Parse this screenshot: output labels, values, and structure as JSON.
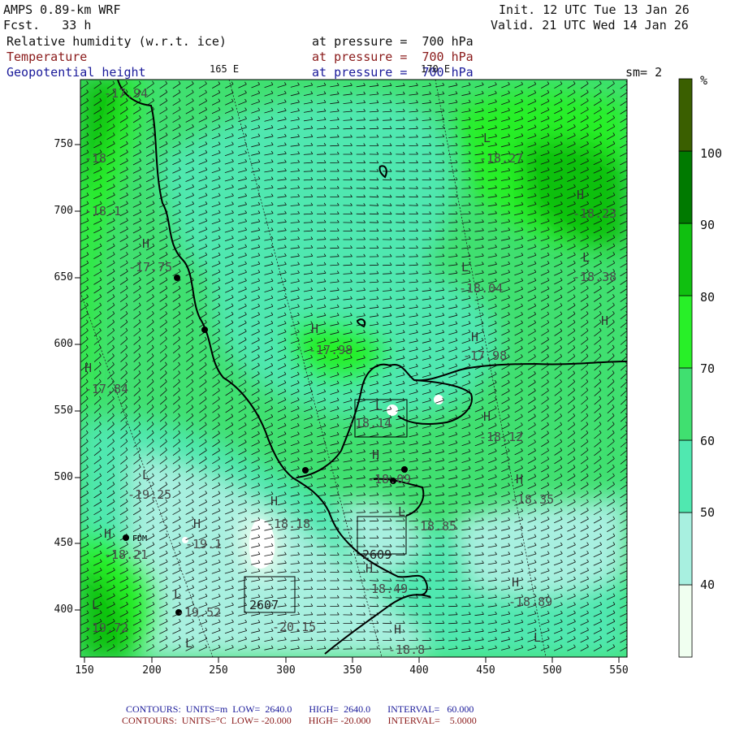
{
  "header": {
    "model": "AMPS 0.89-km WRF",
    "forecast": "Fcst.   33 h",
    "init": "Init. 12 UTC Tue 13 Jan 26",
    "valid": "Valid. 21 UTC Wed 14 Jan 26",
    "field1_name": "Relative humidity (w.r.t. ice)",
    "field1_level": "at pressure =  700 hPa",
    "field2_name": "Temperature",
    "field2_level": "at pressure =  700 hPa",
    "field3_name": "Geopotential height",
    "field3_level": "at pressure =  700 hPa",
    "smoothing": "sm= 2",
    "lon_label_1": "165 E",
    "lon_label_2": "170 E"
  },
  "axes": {
    "y_ticks": [
      "750",
      "700",
      "650",
      "600",
      "550",
      "500",
      "450",
      "400"
    ],
    "x_ticks": [
      "150",
      "200",
      "250",
      "300",
      "350",
      "400",
      "450",
      "500",
      "550"
    ]
  },
  "colorbar": {
    "unit": "%",
    "labels": [
      "100",
      "90",
      "80",
      "70",
      "60",
      "50",
      "40"
    ],
    "colors": [
      "#f0fff0",
      "#a8f0e0",
      "#50e8b0",
      "#40e070",
      "#28f028",
      "#10c010",
      "#007a00",
      "#3a5f00"
    ]
  },
  "annotations": {
    "highs": [
      "H",
      "H",
      "H",
      "H",
      "H",
      "H",
      "H",
      "H",
      "H",
      "H",
      "H",
      "H",
      "H",
      "H",
      "H"
    ],
    "lows": [
      "L",
      "L",
      "L",
      "L",
      "L",
      "L",
      "L",
      "L",
      "L",
      "L"
    ],
    "temps": [
      "-17.94",
      "-18",
      "-18.1",
      "-17.75",
      "-17.84",
      "-17.98",
      "-18.27",
      "-18.23",
      "-18.38",
      "-18.04",
      "-17.98",
      "-18.14",
      "-18.12",
      "-18.09",
      "-18.35",
      "-19.25",
      "-18.18",
      "-18.21",
      "-19.1",
      "-18.85",
      "-18.49",
      "-18.89",
      "-19.52",
      "-19.72",
      "-20.15",
      "-18.8"
    ],
    "boxes": [
      "2609",
      "2607"
    ],
    "station": "FDM"
  },
  "footer": {
    "line1": "CONTOURS:  UNITS=m  LOW=  2640.0       HIGH=  2640.0       INTERVAL=   60.000",
    "line2": "CONTOURS:  UNITS=°C  LOW= -20.000       HIGH= -20.000       INTERVAL=    5.0000"
  }
}
